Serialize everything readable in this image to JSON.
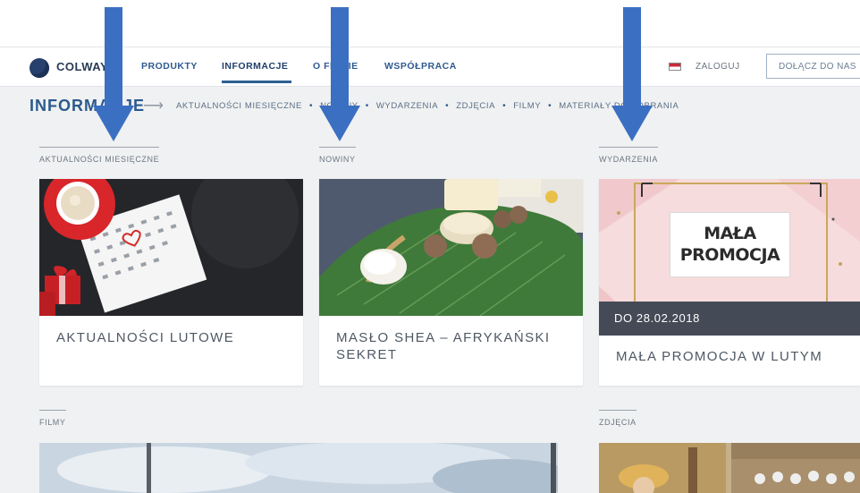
{
  "header": {
    "logo_text": "COLWAY",
    "nav": [
      "PRODUKTY",
      "INFORMACJE",
      "O FIRMIE",
      "WSPÓŁPRACA"
    ],
    "active_nav": "INFORMACJE",
    "login": "ZALOGUJ",
    "join": "DOŁĄCZ DO NAS"
  },
  "page": {
    "title": "INFORMACJE",
    "breadcrumbs": [
      "AKTUALNOŚCI MIESIĘCZNE",
      "NOWINY",
      "WYDARZENIA",
      "ZDJĘCIA",
      "FILMY",
      "MATERIAŁY DO POBRANIA"
    ]
  },
  "sections": {
    "monthly": {
      "label": "AKTUALNOŚCI MIESIĘCZNE",
      "card_title": "AKTUALNOŚCI LUTOWE"
    },
    "news": {
      "label": "NOWINY",
      "card_title": "MASŁO SHEA – AFRYKAŃSKI SEKRET"
    },
    "events": {
      "label": "WYDARZENIA",
      "promo_line1": "MAŁA",
      "promo_line2": "PROMOCJA",
      "date": "DO 28.02.2018",
      "card_title": "MAŁA PROMOCJA W LUTYM"
    },
    "films": {
      "label": "FILMY"
    },
    "photos": {
      "label": "ZDJĘCIA"
    }
  },
  "colors": {
    "brand": "#2c5a8e",
    "annotation_arrow": "#3b6fc2"
  }
}
